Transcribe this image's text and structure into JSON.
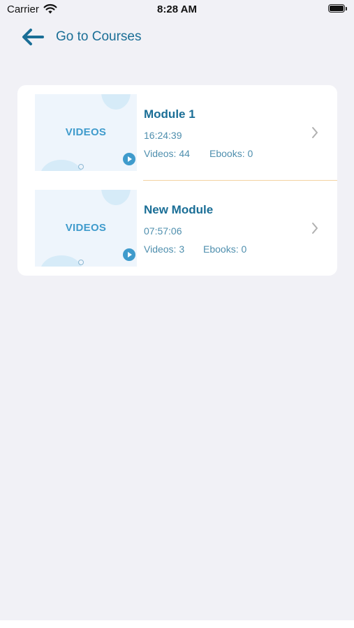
{
  "status_bar": {
    "carrier": "Carrier",
    "time": "8:28 AM"
  },
  "nav": {
    "back_label": "Go to Courses",
    "back_icon": "arrow-left-icon",
    "accent_color": "#1a6e96"
  },
  "modules": [
    {
      "title": "Module 1",
      "duration": "16:24:39",
      "videos_text": "Videos: 44",
      "ebooks_text": "Ebooks: 0",
      "thumbnail_text": "VIDEOS"
    },
    {
      "title": "New Module",
      "duration": "07:57:06",
      "videos_text": "Videos: 3",
      "ebooks_text": "Ebooks: 0",
      "thumbnail_text": "VIDEOS"
    }
  ]
}
